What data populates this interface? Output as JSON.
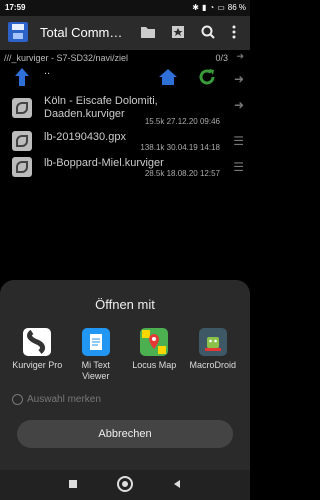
{
  "status": {
    "time": "17:59",
    "battery": "86 %"
  },
  "toolbar": {
    "title": "Total Comm…"
  },
  "path": {
    "text": "///_kurviger - S7-SD32/navi/ziel",
    "count": "0/3"
  },
  "files": [
    {
      "name": "..",
      "meta": ""
    },
    {
      "name": "Köln - Eiscafe Dolomiti, Daaden.kurviger",
      "meta": "15.5k 27.12.20 09:46"
    },
    {
      "name": "lb-20190430.gpx",
      "meta": "138.1k 30.04.19 14:18"
    },
    {
      "name": "lb-Boppard-Miel.kurviger",
      "meta": "28.5k 18.08.20 12:57"
    }
  ],
  "sheet": {
    "title": "Öffnen mit",
    "apps": [
      {
        "label": "Kurviger Pro",
        "icon": "kurviger-icon",
        "color": "#ffffff"
      },
      {
        "label": "Mi Text Viewer",
        "icon": "text-viewer-icon",
        "color": "#2196f3"
      },
      {
        "label": "Locus Map",
        "icon": "locus-map-icon",
        "color": "#4caf50"
      },
      {
        "label": "MacroDroid",
        "icon": "macrodroid-icon",
        "color": "#3f5866"
      }
    ],
    "remember_label": "Auswahl merken",
    "cancel_label": "Abbrechen"
  }
}
